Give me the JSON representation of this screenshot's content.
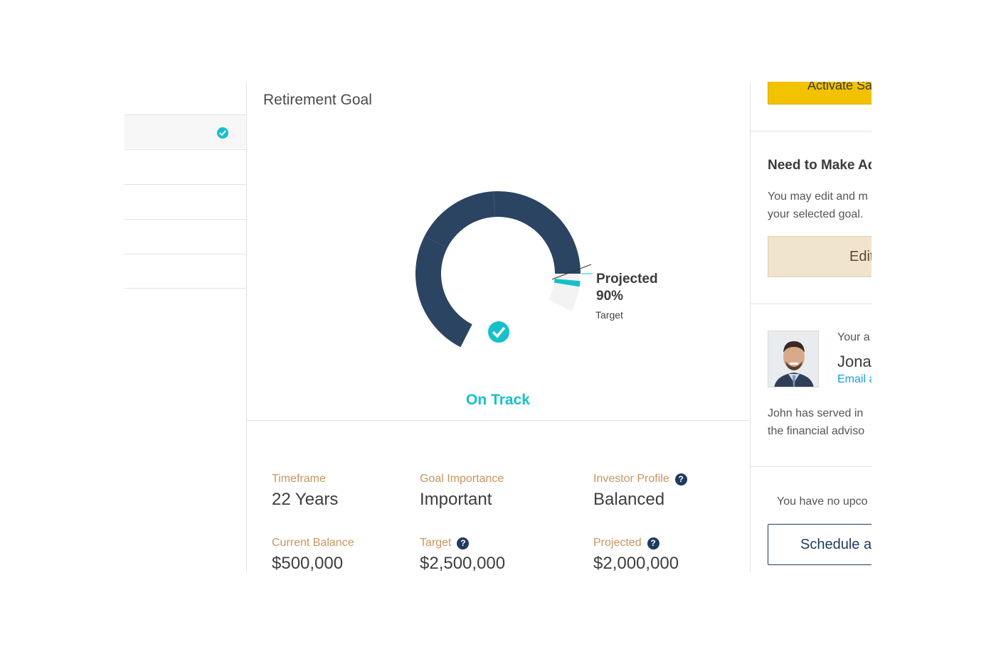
{
  "main": {
    "title": "Retirement Goal",
    "status": "On Track",
    "projected_label": "Projected",
    "projected_pct": "90%",
    "target_label": "Target"
  },
  "chart_data": {
    "type": "pie",
    "title": "",
    "projected_fraction": 0.9,
    "target_fraction": 1.0,
    "series": [
      {
        "name": "Projected",
        "value": 90,
        "color": "#2b4462"
      },
      {
        "name": "Target",
        "value": 100,
        "color": "#16c0c9"
      }
    ]
  },
  "stats": [
    {
      "label": "Timeframe",
      "value": "22 Years",
      "help": false
    },
    {
      "label": "Goal Importance",
      "value": "Important",
      "help": false
    },
    {
      "label": "Investor Profile",
      "value": "Balanced",
      "help": true
    },
    {
      "label": "Current Balance",
      "value": "$500,000",
      "help": false
    },
    {
      "label": "Target",
      "value": "$2,500,000",
      "help": true
    },
    {
      "label": "Projected",
      "value": "$2,000,000",
      "help": true
    }
  ],
  "right": {
    "activate_label": "Activate Sa",
    "adjust_heading": "Need to Make Ad",
    "adjust_text_1": "You may edit and m",
    "adjust_text_2": "your selected goal.",
    "edit_label": "Edit",
    "advisor_label": "Your a",
    "advisor_name": "Jona",
    "advisor_email": "Email a",
    "advisor_bio_1": "John has served in",
    "advisor_bio_2": "the financial adviso",
    "appointments_text": "You have no upco",
    "schedule_label": "Schedule ar"
  },
  "colors": {
    "accent": "#16c0c9",
    "navy": "#2b4462",
    "gold": "#c8955e",
    "yellow": "#f2c200",
    "edit_bg": "#f1e4cc"
  },
  "help_icon": "?"
}
